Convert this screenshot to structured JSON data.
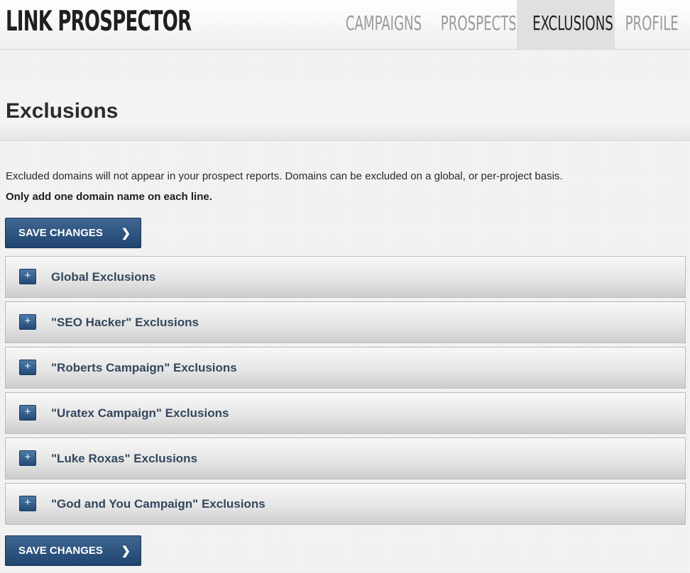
{
  "app": {
    "logo": "LINK PROSPECTOR"
  },
  "nav": {
    "tabs": [
      {
        "label": "CAMPAIGNS",
        "active": false
      },
      {
        "label": "PROSPECTS",
        "active": false
      },
      {
        "label": "EXCLUSIONS",
        "active": true
      },
      {
        "label": "PROFILE",
        "active": false
      }
    ]
  },
  "page": {
    "title": "Exclusions",
    "intro": "Excluded domains will not appear in your prospect reports. Domains can be excluded on a global, or per-project basis.",
    "note": "Only add one domain name on each line."
  },
  "actions": {
    "save_label": "SAVE CHANGES",
    "save_icon": "chevron-right-icon"
  },
  "panels": [
    {
      "title": "Global Exclusions",
      "toggle": "+"
    },
    {
      "title": "\"SEO Hacker\" Exclusions",
      "toggle": "+"
    },
    {
      "title": "\"Roberts Campaign\" Exclusions",
      "toggle": "+"
    },
    {
      "title": "\"Uratex Campaign\" Exclusions",
      "toggle": "+"
    },
    {
      "title": "\"Luke Roxas\" Exclusions",
      "toggle": "+"
    },
    {
      "title": "\"God and You Campaign\" Exclusions",
      "toggle": "+"
    }
  ],
  "colors": {
    "accent": "#2a5078",
    "panel_text": "#34475e"
  }
}
